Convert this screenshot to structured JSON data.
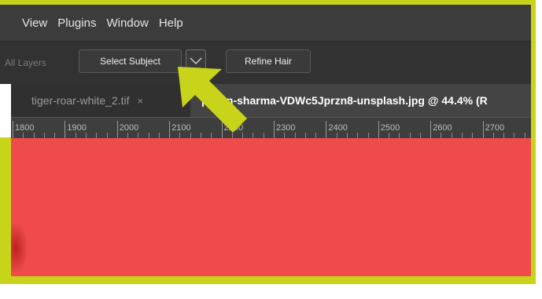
{
  "menubar": {
    "items": [
      "View",
      "Plugins",
      "Window",
      "Help"
    ]
  },
  "options_bar": {
    "sample_label": "All Layers",
    "select_subject_label": "Select Subject",
    "dropdown_icon": "chevron-down-icon",
    "refine_hair_label": "Refine Hair"
  },
  "tabs": [
    {
      "label": "tiger-roar-white_2.tif",
      "close": "×"
    },
    {
      "label": "pavan-sharma-VDWc5Jprzn8-unsplash.jpg @ 44.4% (R"
    }
  ],
  "ruler": {
    "labels": [
      "1800",
      "1900",
      "2000",
      "2100",
      "2200",
      "2300",
      "2400",
      "2500",
      "2600",
      "2700"
    ]
  },
  "colors": {
    "highlight": "#c8d41a",
    "overlay": "#f04b4b",
    "arrow": "#c8d41a"
  }
}
